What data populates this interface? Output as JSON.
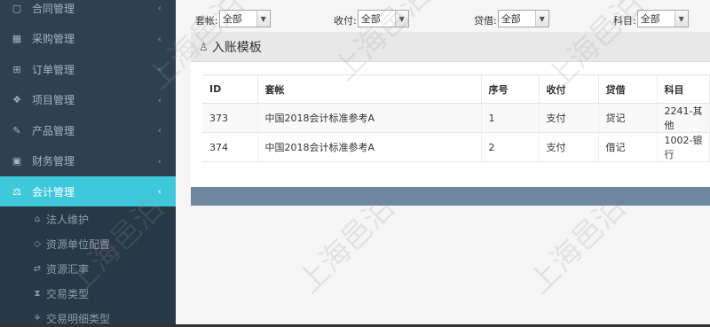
{
  "sidebar": {
    "items": [
      {
        "label": "合同管理",
        "icon": "document-icon"
      },
      {
        "label": "采购管理",
        "icon": "grid-icon"
      },
      {
        "label": "订单管理",
        "icon": "cart-icon"
      },
      {
        "label": "项目管理",
        "icon": "cubes-icon"
      },
      {
        "label": "产品管理",
        "icon": "edit-icon"
      },
      {
        "label": "财务管理",
        "icon": "money-icon"
      },
      {
        "label": "会计管理",
        "icon": "balance-scale-icon"
      }
    ],
    "sub_items": [
      {
        "label": "法人维护",
        "icon": "bank-icon"
      },
      {
        "label": "资源单位配置",
        "icon": "diamond-icon"
      },
      {
        "label": "资源汇率",
        "icon": "exchange-icon"
      },
      {
        "label": "交易类型",
        "icon": "hourglass-icon"
      },
      {
        "label": "交易明细类型",
        "icon": "sitemap-icon"
      }
    ]
  },
  "filters": {
    "account_set": {
      "label": "套帐:",
      "value": "全部"
    },
    "payment": {
      "label": "收付:",
      "value": "全部"
    },
    "debit_credit": {
      "label": "贷借:",
      "value": "全部"
    },
    "subject": {
      "label": "科目:",
      "value": "全部"
    }
  },
  "panel": {
    "title": "入账模板",
    "columns": [
      "ID",
      "套帐",
      "序号",
      "收付",
      "贷借",
      "科目"
    ],
    "rows": [
      [
        "373",
        "中国2018会计标准参考A",
        "1",
        "支付",
        "贷记",
        "2241-其他"
      ],
      [
        "374",
        "中国2018会计标准参考A",
        "2",
        "支付",
        "借记",
        "1002-银行"
      ]
    ]
  },
  "watermark": "上海邑泊",
  "colors": {
    "sidebar_bg": "#2f4050",
    "active": "#3fc8dc",
    "footer_bar": "#6f879f"
  }
}
